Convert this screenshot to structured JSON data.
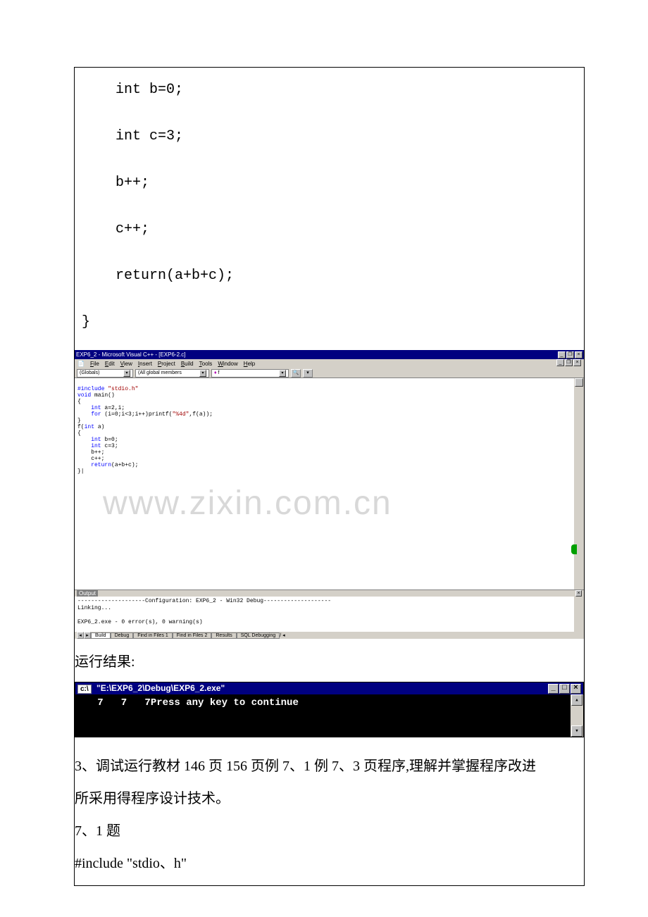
{
  "code_top": {
    "l1": "    int b=0;",
    "l2": "    int c=3;",
    "l3": "    b++;",
    "l4": "    c++;",
    "l5": "    return(a+b+c);",
    "l6": "}"
  },
  "ide": {
    "title": "EXP6_2 - Microsoft Visual C++ - [EXP6-2.c]",
    "menus": [
      "File",
      "Edit",
      "View",
      "Insert",
      "Project",
      "Build",
      "Tools",
      "Window",
      "Help"
    ],
    "combo1": "(Globals)",
    "combo2": "(All global members ",
    "combo3": " f",
    "src": {
      "l1": {
        "pre": "#include ",
        "str": "\"stdio.h\""
      },
      "l2": {
        "kw": "void",
        "rest": " main()"
      },
      "l3": "{",
      "l4": {
        "pre": "    ",
        "kw": "int",
        "rest": " a=2,i;"
      },
      "l5": {
        "pre": "    ",
        "kw": "for",
        "mid": " (i=0;i<3;i++)printf(",
        "str": "\"%4d\"",
        "rest": ",f(a));"
      },
      "l6": "}",
      "l7": {
        "pre": "f(",
        "kw": "int",
        "rest": " a)"
      },
      "l8": "{",
      "l9": {
        "pre": "    ",
        "kw": "int",
        "rest": " b=0;"
      },
      "l10": {
        "pre": "    ",
        "kw": "int",
        "rest": " c=3;"
      },
      "l11": "    b++;",
      "l12": "    c++;",
      "l13": {
        "pre": "    ",
        "kw": "return",
        "rest": "(a+b+c);"
      },
      "l14": "}|"
    },
    "watermark": "www.zixin.com.cn"
  },
  "output": {
    "title": "Output",
    "l1": "--------------------Configuration: EXP6_2 - Win32 Debug--------------------",
    "l2": "Linking...",
    "l3": "",
    "l4": "EXP6_2.exe - 0 error(s), 0 warning(s)",
    "tabs": [
      "Build",
      "Debug",
      "Find in Files 1",
      "Find in Files 2",
      "Results",
      "SQL Debugging"
    ]
  },
  "result_label": "运行结果:",
  "console": {
    "icon": "c:\\",
    "title": "\"E:\\EXP6_2\\Debug\\EXP6_2.exe\"",
    "body": "   7   7   7Press any key to continue"
  },
  "body_text": {
    "p1_indent": "   3、调试运行教材 146 页 156 页例 7、1 例 7、3 页程序,理解并掌握程序改进",
    "p2": "所采用得程序设计技术。",
    "p3": "7、1 题",
    "p4": "#include \"stdio、h\""
  },
  "winbtn": {
    "min": "_",
    "max": "□",
    "close": "×",
    "restore": "❐"
  }
}
